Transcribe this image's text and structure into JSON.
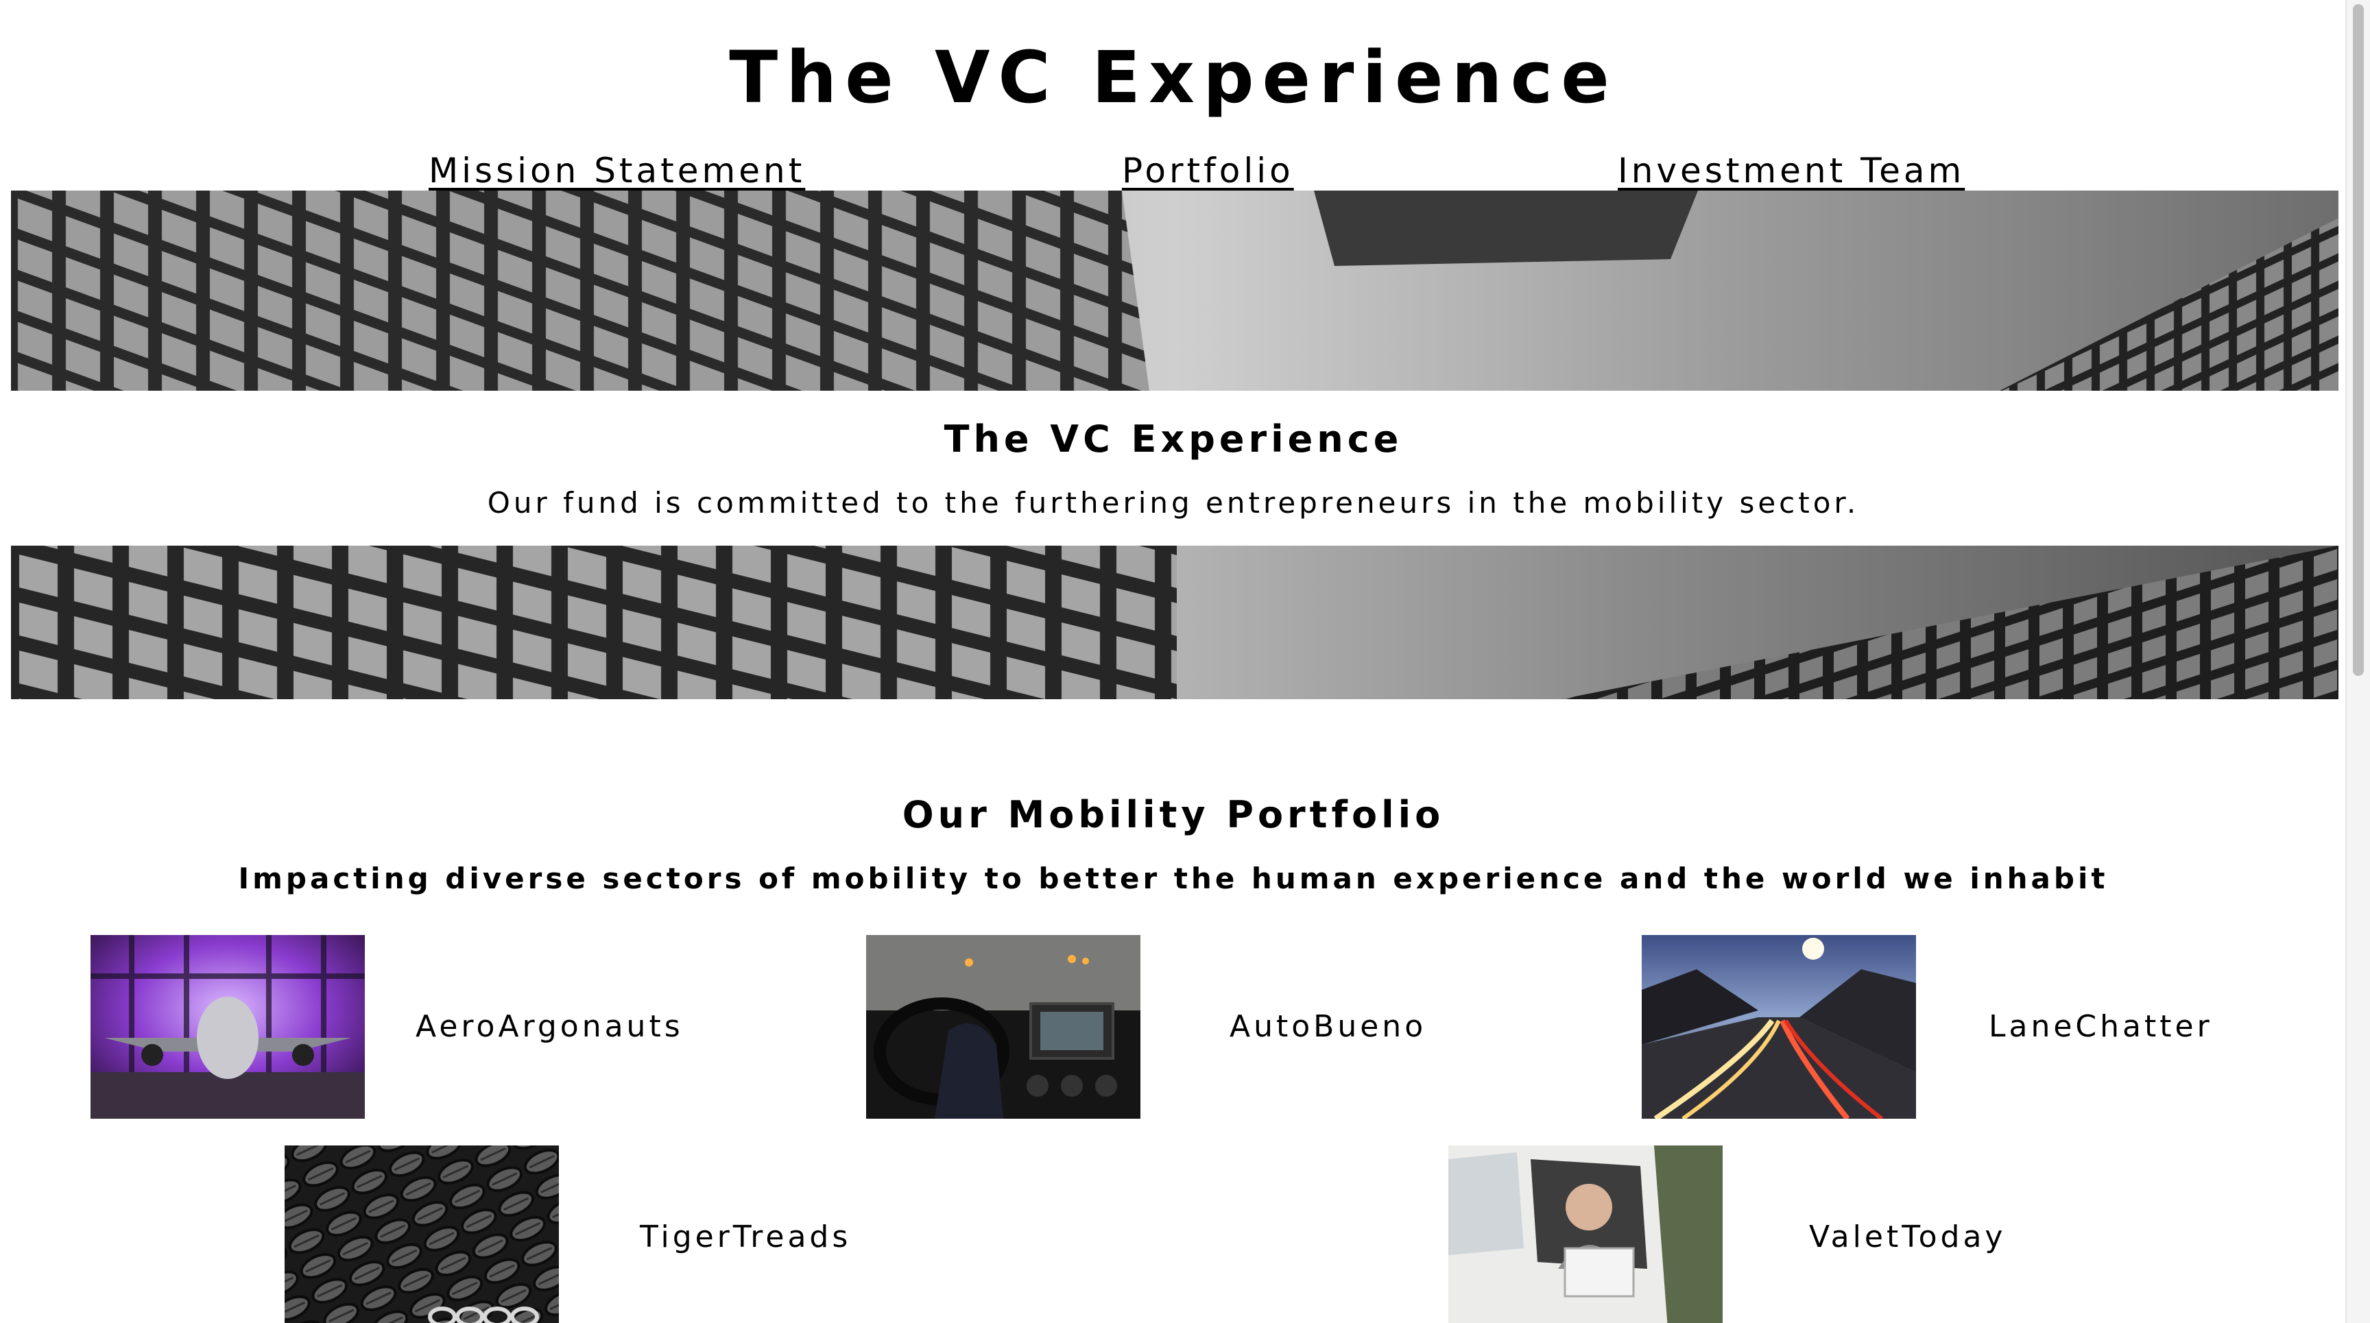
{
  "site": {
    "title": "The VC Experience"
  },
  "nav": {
    "items": [
      "Mission Statement",
      "Portfolio",
      "Investment Team"
    ]
  },
  "mission": {
    "title": "The VC Experience",
    "text": "Our fund is committed to the furthering entrepreneurs in the mobility sector."
  },
  "portfolio": {
    "title": "Our Mobility Portfolio",
    "subtitle": "Impacting diverse sectors of mobility to better the human experience and the world we inhabit",
    "companies": [
      {
        "name": "AeroArgonauts",
        "image": "airplane-hangar-photo"
      },
      {
        "name": "AutoBueno",
        "image": "car-dashboard-photo"
      },
      {
        "name": "LaneChatter",
        "image": "highway-light-trails-photo"
      },
      {
        "name": "TigerTreads",
        "image": "tire-pile-photo"
      },
      {
        "name": "ValetToday",
        "image": "driver-in-van-photo"
      }
    ]
  },
  "images": {
    "banner_top": "building-facade-sky-banner",
    "banner_bottom": "building-facade-sky-banner"
  }
}
